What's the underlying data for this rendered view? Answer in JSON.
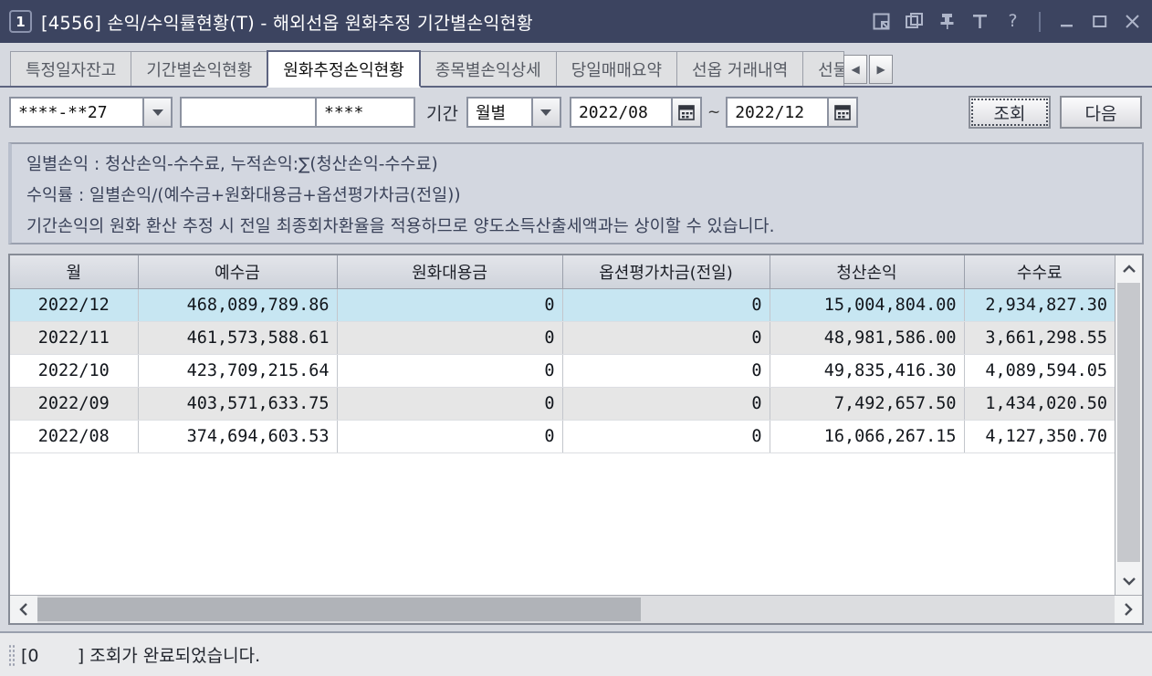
{
  "window": {
    "number": "1",
    "title": "[4556] 손익/수익률현황(T) - 해외선옵 원화추정 기간별손익현황",
    "icons": [
      {
        "name": "snap-window-icon",
        "glyph": "snap"
      },
      {
        "name": "duplicate-window-icon",
        "glyph": "duplicate"
      },
      {
        "name": "pin-icon",
        "glyph": "pin"
      },
      {
        "name": "text-size-icon",
        "glyph": "T"
      },
      {
        "name": "help-icon",
        "glyph": "?"
      },
      {
        "name": "minimize-icon",
        "glyph": "minimize"
      },
      {
        "name": "maximize-icon",
        "glyph": "maximize"
      },
      {
        "name": "close-icon",
        "glyph": "close"
      }
    ]
  },
  "tabs": {
    "items": [
      {
        "label": "특정일자잔고",
        "active": false
      },
      {
        "label": "기간별손익현황",
        "active": false
      },
      {
        "label": "원화추정손익현황",
        "active": true
      },
      {
        "label": "종목별손익상세",
        "active": false
      },
      {
        "label": "당일매매요약",
        "active": false
      },
      {
        "label": "선옵 거래내역",
        "active": false
      },
      {
        "label": "선물",
        "active": false
      }
    ],
    "scroll_left": "◀",
    "scroll_right": "▶"
  },
  "toolbar": {
    "account_value": "****-**27",
    "account_placeholder": "",
    "name_value": "",
    "name_placeholder": "",
    "password_value": "****",
    "password_placeholder": "",
    "period_label": "기간",
    "period_type": "월별",
    "date_from": "2022/08",
    "date_to": "2022/12",
    "range_separator": "~",
    "query_button": "조회",
    "next_button": "다음"
  },
  "info": {
    "lines": [
      "일별손익 : 청산손익-수수료, 누적손익:∑(청산손익-수수료)",
      "수익률    : 일별손익/(예수금+원화대용금+옵션평가차금(전일))",
      "기간손익의 원화 환산 추정 시 전일 최종회차환율을 적용하므로 양도소득산출세액과는 상이할 수 있습니다."
    ]
  },
  "grid": {
    "columns": [
      "월",
      "예수금",
      "원화대용금",
      "옵션평가차금(전일)",
      "청산손익",
      "수수료"
    ],
    "rows": [
      {
        "month": "2022/12",
        "deposit": "468,089,789.86",
        "krw_substitute": "0",
        "option_valuation": "0",
        "settlement_pl": "15,004,804.00",
        "fee": "2,934,827.30",
        "style": "sel"
      },
      {
        "month": "2022/11",
        "deposit": "461,573,588.61",
        "krw_substitute": "0",
        "option_valuation": "0",
        "settlement_pl": "48,981,586.00",
        "fee": "3,661,298.55",
        "style": "alt"
      },
      {
        "month": "2022/10",
        "deposit": "423,709,215.64",
        "krw_substitute": "0",
        "option_valuation": "0",
        "settlement_pl": "49,835,416.30",
        "fee": "4,089,594.05",
        "style": "plain"
      },
      {
        "month": "2022/09",
        "deposit": "403,571,633.75",
        "krw_substitute": "0",
        "option_valuation": "0",
        "settlement_pl": "7,492,657.50",
        "fee": "1,434,020.50",
        "style": "alt"
      },
      {
        "month": "2022/08",
        "deposit": "374,694,603.53",
        "krw_substitute": "0",
        "option_valuation": "0",
        "settlement_pl": "16,066,267.15",
        "fee": "4,127,350.70",
        "style": "plain"
      }
    ]
  },
  "status": {
    "text": "[0       ] 조회가 완료되었습니다."
  },
  "colors": {
    "titlebar": "#3c4460",
    "accent_positive": "#e0564a",
    "selected_row": "#c7e6f2",
    "panel": "#d6d9e0"
  }
}
